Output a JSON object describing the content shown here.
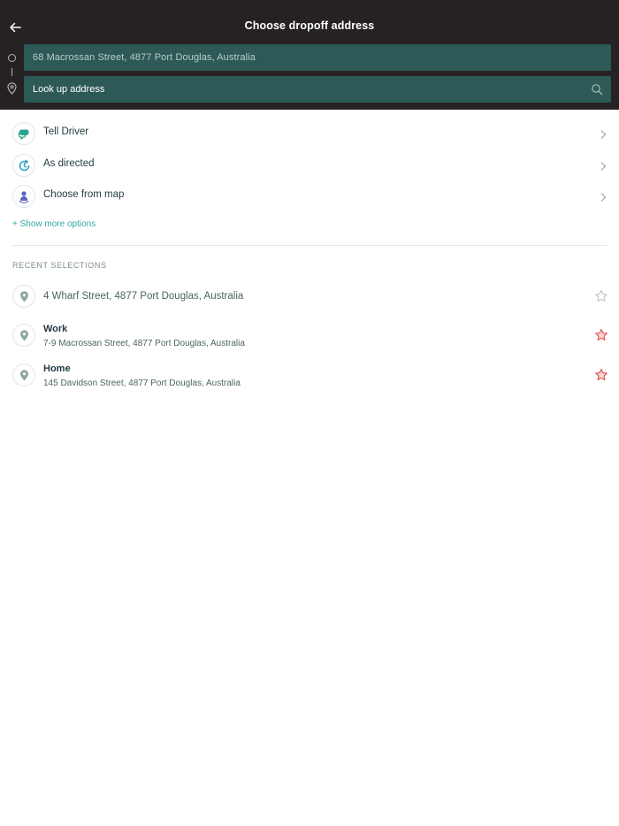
{
  "header": {
    "title": "Choose dropoff address",
    "origin_address": "68 Macrossan Street, 4877 Port Douglas, Australia",
    "destination_placeholder": "Look up address"
  },
  "options": [
    {
      "label": "Tell Driver",
      "icon": "chat-bubbles-icon"
    },
    {
      "label": "As directed",
      "icon": "clock-refresh-icon"
    },
    {
      "label": "Choose from map",
      "icon": "map-person-pin-icon"
    }
  ],
  "show_more_label": "+ Show more options",
  "recent": {
    "heading": "RECENT SELECTIONS",
    "items": [
      {
        "name": "",
        "address": "4 Wharf Street, 4877 Port Douglas, Australia",
        "favorite": false
      },
      {
        "name": "Work",
        "address": "7-9 Macrossan Street, 4877 Port Douglas, Australia",
        "favorite": true
      },
      {
        "name": "Home",
        "address": "145 Davidson Street, 4877 Port Douglas, Australia",
        "favorite": true
      }
    ]
  },
  "colors": {
    "header_bg": "#262224",
    "field_bg": "#2d5a56",
    "accent_teal": "#33a99e",
    "favorite_star": "#e2504f",
    "pin_gray": "#90a5a3"
  }
}
